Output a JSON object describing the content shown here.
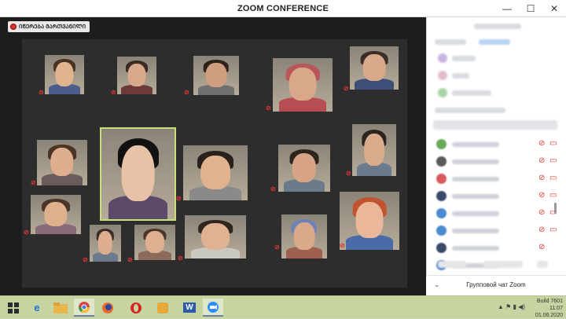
{
  "window": {
    "title": "ZOOM CONFERENCE",
    "minimize": "—",
    "restore": "☐",
    "close": "✕"
  },
  "recording": {
    "label": "ᲘᲬᲔᲠᲔᲑᲐ ᲛᲐᲠᲗᲕᲐᲜᲘᲚᲘ"
  },
  "tiles": [
    {
      "skin": "#e0b48e",
      "hair": "#4a3224",
      "body": "#4b5e8a"
    },
    {
      "skin": "#d9a98c",
      "hair": "#3a2a22",
      "body": "#6d3a3a"
    },
    {
      "skin": "#cf9e80",
      "hair": "#2e221d",
      "body": "#707070"
    },
    {
      "skin": "#d9a88a",
      "hair": "#b8565a",
      "body": "#b74d52"
    },
    {
      "skin": "#d8a98a",
      "hair": "#3b2e28",
      "body": "#3f4f7a"
    },
    {
      "skin": "#deae8e",
      "hair": "#4b3326",
      "body": "#6b5b5b"
    },
    {
      "skin": "#e7c2a6",
      "hair": "#111111",
      "body": "#5c4a6b"
    },
    {
      "skin": "#e2b28f",
      "hair": "#2a211c",
      "body": "#8a8a8a"
    },
    {
      "skin": "#d7a488",
      "hair": "#2e241e",
      "body": "#6a7b8a"
    },
    {
      "skin": "#d8ab8b",
      "hair": "#2c241f",
      "body": "#6b7a8c"
    },
    {
      "skin": "#deb08e",
      "hair": "#4a3528",
      "body": "#8a6a7a"
    },
    {
      "skin": "#dcae8f",
      "hair": "#3a2d25",
      "body": "#6b7a8c"
    },
    {
      "skin": "#deaf90",
      "hair": "#4b3528",
      "body": "#8a6a5a"
    },
    {
      "skin": "#e0b292",
      "hair": "#2f241e",
      "body": "#c9c9c0"
    },
    {
      "skin": "#d9a98a",
      "hair": "#6e82b8",
      "body": "#a06050"
    },
    {
      "skin": "#eab79a",
      "hair": "#c1542e",
      "body": "#4a6aa8"
    }
  ],
  "sidebar": {
    "avatar_colors": [
      "#6aaa5a",
      "#5a5a5a",
      "#d85a5a",
      "#3a4a6a",
      "#4a8ad0",
      "#4a8ad0",
      "#3a4a6a",
      "#4a8ad0"
    ],
    "mic_icon": "mic-muted-icon",
    "cam_icon": "camera-off-icon"
  },
  "chat": {
    "title": "Групповой чат Zoom",
    "chevron": "⌄"
  },
  "taskbar": {
    "clock_line1": "11:07",
    "clock_line2": "01.06.2020",
    "build": "Build 7601",
    "tray": "▲ ⚑ ▮ ◀)"
  },
  "colors": {
    "accent_muted": "#e03333",
    "active_speaker": "#c9e07a",
    "taskbar": "#c5d4a0"
  }
}
